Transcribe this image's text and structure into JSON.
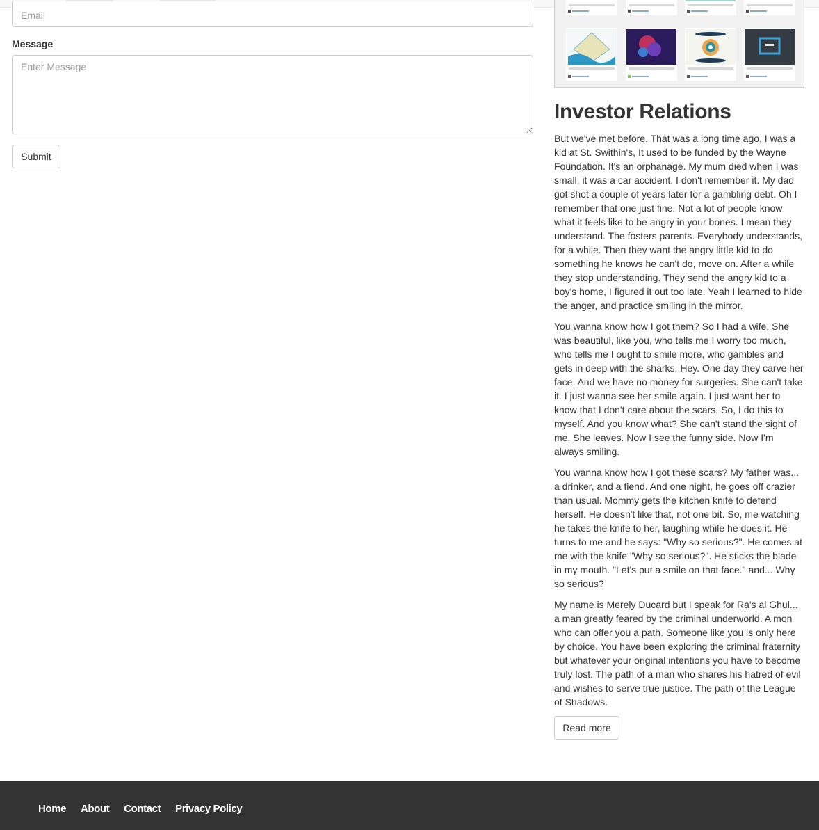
{
  "form": {
    "email_placeholder": "Email",
    "message_label": "Message",
    "message_placeholder": "Enter Message",
    "submit_label": "Submit"
  },
  "sidebar": {
    "title": "Investor Relations",
    "paragraphs": [
      "But we've met before. That was a long time ago, I was a kid at St. Swithin's, It used to be funded by the Wayne Foundation. It's an orphanage. My mum died when I was small, it was a car accident. I don't remember it. My dad got shot a couple of years later for a gambling debt. Oh I remember that one just fine. Not a lot of people know what it feels like to be angry in your bones. I mean they understand. The fosters parents. Everybody understands, for a while. Then they want the angry little kid to do something he knows he can't do, move on. After a while they stop understanding. They send the angry kid to a boy's home, I figured it out too late. Yeah I learned to hide the anger, and practice smiling in the mirror.",
      "You wanna know how I got them? So I had a wife. She was beautiful, like you, who tells me I worry too much, who tells me I ought to smile more, who gambles and gets in deep with the sharks. Hey. One day they carve her face. And we have no money for surgeries. She can't take it. I just wanna see her smile again. I just want her to know that I don't care about the scars. So, I do this to myself. And you know what? She can't stand the sight of me. She leaves. Now I see the funny side. Now I'm always smiling.",
      "You wanna know how I got these scars? My father was... a drinker, and a fiend. And one night, he goes off crazier than usual. Mommy gets the kitchen knife to defend herself. He doesn't like that, not one bit. So, me watching he takes the knife to her, laughing while he does it. He turns to me and he says: \"Why so serious?\". He comes at me with the knife \"Why so serious?\". He sticks the blade in my mouth. \"Let's put a smile on that face.\" and... Why so serious?",
      "My name is Merely Ducard but I speak for Ra's al Ghul... a man greatly feared by the criminal underworld. A mon who can offer you a path. Someone like you is only here by choice. You have been exploring the criminal fraternity but whatever your original intentions you have to become truly lost. The path of a man who shares his hatred of evil and wishes to serve true justice. The path of the League of Shadows."
    ],
    "read_more_label": "Read more"
  },
  "footer": {
    "links": [
      "Home",
      "About",
      "Contact",
      "Privacy Policy"
    ]
  }
}
